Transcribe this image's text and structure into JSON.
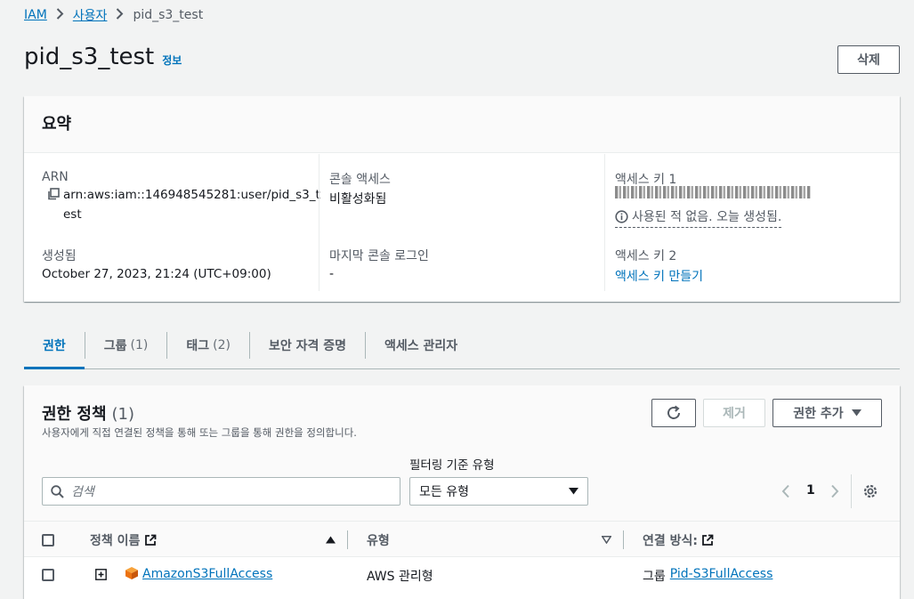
{
  "breadcrumb": {
    "root": "IAM",
    "parent": "사용자",
    "current": "pid_s3_test"
  },
  "header": {
    "title": "pid_s3_test",
    "info": "정보",
    "delete_label": "삭제"
  },
  "summary": {
    "title": "요약",
    "arn_label": "ARN",
    "arn_line1": "arn:aws:iam::146948545281:user/pid_s3_t",
    "arn_line2": "est",
    "created_label": "생성됨",
    "created_value": "October 27, 2023, 21:24 (UTC+09:00)",
    "console_label": "콘솔 액세스",
    "console_value": "비활성화됨",
    "last_login_label": "마지막 콘솔 로그인",
    "last_login_value": "-",
    "key1_label": "액세스 키 1",
    "key1_note": "사용된 적 없음. 오늘 생성됨.",
    "key2_label": "액세스 키 2",
    "key2_create": "액세스 키 만들기"
  },
  "tabs": [
    {
      "label": "권한",
      "count": ""
    },
    {
      "label": "그룹",
      "count": "(1)"
    },
    {
      "label": "태그",
      "count": "(2)"
    },
    {
      "label": "보안 자격 증명",
      "count": ""
    },
    {
      "label": "액세스 관리자",
      "count": ""
    }
  ],
  "permissions": {
    "title": "권한 정책",
    "count": "(1)",
    "description": "사용자에게 직접 연결된 정책을 통해 또는 그룹을 통해 권한을 정의합니다.",
    "remove_label": "제거",
    "add_label": "권한 추가",
    "search_placeholder": "검색",
    "filter_label": "필터링 기준 유형",
    "filter_value": "모든 유형",
    "page": "1",
    "columns": {
      "name": "정책 이름",
      "type": "유형",
      "attached": "연결 방식:"
    },
    "rows": [
      {
        "name": "AmazonS3FullAccess",
        "type": "AWS 관리형",
        "attached_prefix": "그룹",
        "attached_link": "Pid-S3FullAccess"
      }
    ]
  },
  "colors": {
    "link": "#0073bb",
    "text": "#16191f",
    "secondary": "#545b64",
    "background": "#f2f3f3",
    "aws_orange": "#ec7211"
  }
}
